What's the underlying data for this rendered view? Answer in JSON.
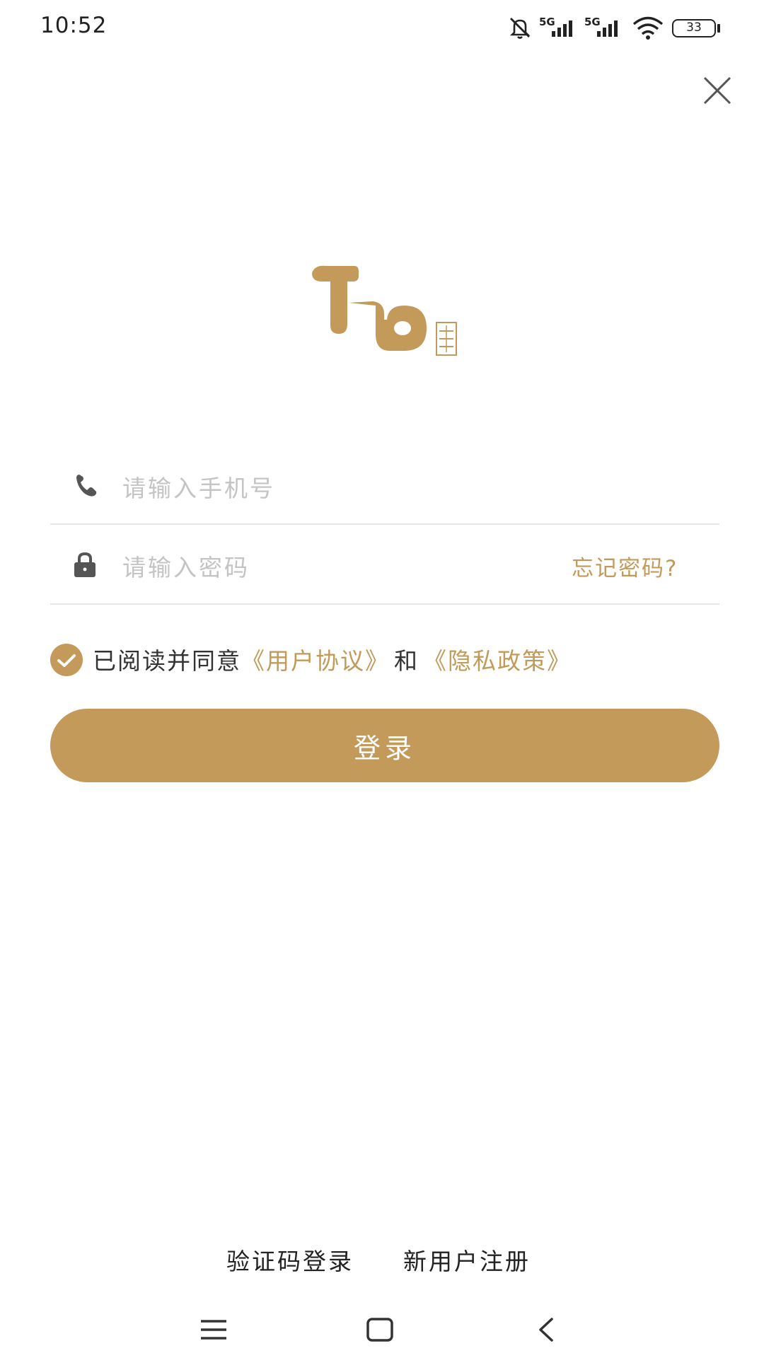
{
  "status_bar": {
    "time": "10:52",
    "network_1": "5G",
    "network_2": "5G",
    "battery": "33",
    "icons": [
      "mute-icon",
      "signal-icon",
      "signal-icon",
      "wifi-icon",
      "battery-icon"
    ]
  },
  "close_icon": "close-icon",
  "login_form": {
    "phone_placeholder": "请输入手机号",
    "password_placeholder": "请输入密码",
    "forgot_password": "忘记密码?",
    "phone_icon": "phone-icon",
    "lock_icon": "lock-icon"
  },
  "agreement": {
    "prefix": "已阅读并同意",
    "user_agreement": "《用户协议》",
    "and": "和",
    "privacy_policy": "《隐私政策》",
    "checked": true
  },
  "login_button": "登录",
  "bottom_links": {
    "sms_login": "验证码登录",
    "register": "新用户注册"
  },
  "nav_bar": [
    "menu-icon",
    "home-icon",
    "back-icon"
  ],
  "colors": {
    "accent": "#c39a5a",
    "text": "#333333",
    "placeholder": "#c4c4c4",
    "divider": "#e6e6e6"
  }
}
